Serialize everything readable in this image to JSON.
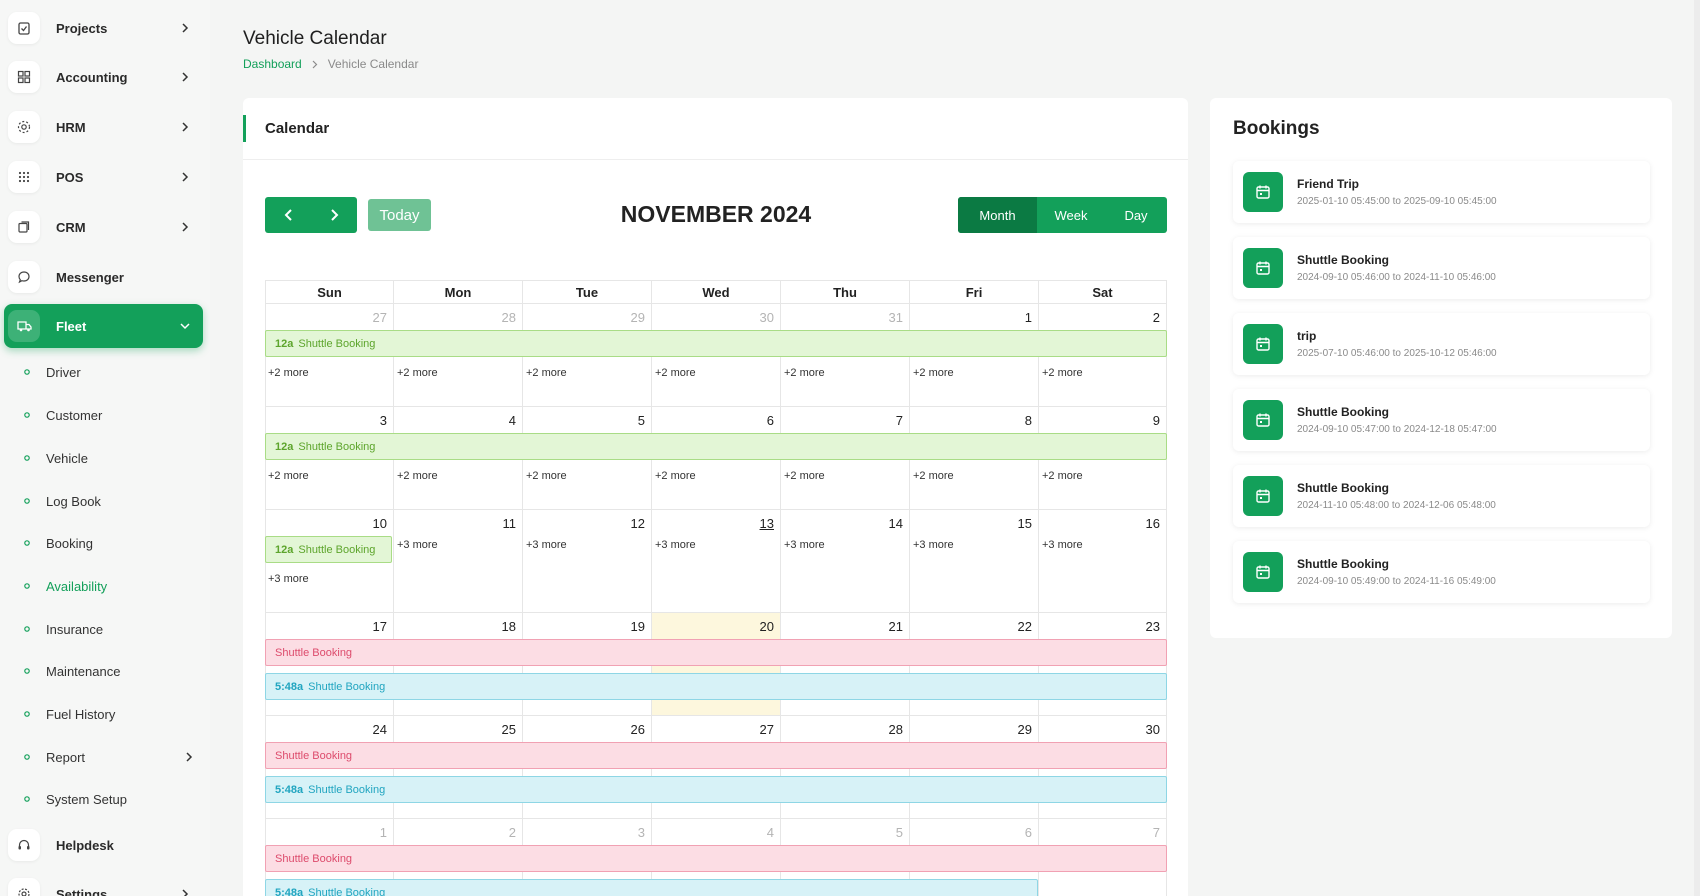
{
  "sidebar": {
    "items": [
      {
        "label": "Projects",
        "icon": "clipboard-check-icon"
      },
      {
        "label": "Accounting",
        "icon": "grid-icon"
      },
      {
        "label": "HRM",
        "icon": "users-icon"
      },
      {
        "label": "POS",
        "icon": "dots-grid-icon"
      },
      {
        "label": "CRM",
        "icon": "layers-icon"
      },
      {
        "label": "Messenger",
        "icon": "chat-icon"
      },
      {
        "label": "Fleet",
        "icon": "truck-icon"
      },
      {
        "label": "Helpdesk",
        "icon": "headset-icon"
      },
      {
        "label": "Settings",
        "icon": "gear-icon"
      }
    ],
    "fleet_sub": [
      "Driver",
      "Customer",
      "Vehicle",
      "Log Book",
      "Booking",
      "Availability",
      "Insurance",
      "Maintenance",
      "Fuel History",
      "Report",
      "System Setup"
    ],
    "active_sub": "Availability"
  },
  "header": {
    "title": "Vehicle Calendar",
    "breadcrumb": [
      "Dashboard",
      "Vehicle Calendar"
    ]
  },
  "calendar": {
    "card_title": "Calendar",
    "today_label": "Today",
    "month_title": "NOVEMBER 2024",
    "views": [
      "Month",
      "Week",
      "Day"
    ],
    "active_view": "Month",
    "weekdays": [
      "Sun",
      "Mon",
      "Tue",
      "Wed",
      "Thu",
      "Fri",
      "Sat"
    ],
    "weeks": [
      {
        "days": [
          "27",
          "28",
          "29",
          "30",
          "31",
          "1",
          "2"
        ],
        "other": [
          true,
          true,
          true,
          true,
          true,
          false,
          false
        ]
      },
      {
        "days": [
          "3",
          "4",
          "5",
          "6",
          "7",
          "8",
          "9"
        ],
        "other": [
          false,
          false,
          false,
          false,
          false,
          false,
          false
        ]
      },
      {
        "days": [
          "10",
          "11",
          "12",
          "13",
          "14",
          "15",
          "16"
        ],
        "other": [
          false,
          false,
          false,
          false,
          false,
          false,
          false
        ]
      },
      {
        "days": [
          "17",
          "18",
          "19",
          "20",
          "21",
          "22",
          "23"
        ],
        "other": [
          false,
          false,
          false,
          false,
          false,
          false,
          false
        ]
      },
      {
        "days": [
          "24",
          "25",
          "26",
          "27",
          "28",
          "29",
          "30"
        ],
        "other": [
          false,
          false,
          false,
          false,
          false,
          false,
          false
        ]
      },
      {
        "days": [
          "1",
          "2",
          "3",
          "4",
          "5",
          "6",
          "7"
        ],
        "other": [
          true,
          true,
          true,
          true,
          true,
          true,
          true
        ]
      }
    ],
    "today": "13",
    "highlight_day": "20",
    "more_labels": {
      "w1": [
        "+2 more",
        "+2 more",
        "+2 more",
        "+2 more",
        "+2 more",
        "+2 more",
        "+2 more"
      ],
      "w2": [
        "+2 more",
        "+2 more",
        "+2 more",
        "+2 more",
        "+2 more",
        "+2 more",
        "+2 more"
      ],
      "w3_sun": "+3 more",
      "w3": [
        "+3 more",
        "+3 more",
        "+3 more",
        "+3 more",
        "+3 more",
        "+3 more"
      ]
    },
    "events": {
      "green_time": "12a",
      "green_title": "Shuttle Booking",
      "pink_title": "Shuttle Booking",
      "cyan_time": "5:48a",
      "cyan_title": "Shuttle Booking"
    },
    "colors": {
      "green": "#e3f6d6",
      "pink": "#fcdde4",
      "cyan": "#d7f2f7",
      "accent": "#13a05a"
    }
  },
  "bookings": {
    "title": "Bookings",
    "items": [
      {
        "name": "Friend Trip",
        "range": "2025-01-10 05:45:00 to 2025-09-10 05:45:00"
      },
      {
        "name": "Shuttle Booking",
        "range": "2024-09-10 05:46:00 to 2024-11-10 05:46:00"
      },
      {
        "name": "trip",
        "range": "2025-07-10 05:46:00 to 2025-10-12 05:46:00"
      },
      {
        "name": "Shuttle Booking",
        "range": "2024-09-10 05:47:00 to 2024-12-18 05:47:00"
      },
      {
        "name": "Shuttle Booking",
        "range": "2024-11-10 05:48:00 to 2024-12-06 05:48:00"
      },
      {
        "name": "Shuttle Booking",
        "range": "2024-09-10 05:49:00 to 2024-11-16 05:49:00"
      }
    ]
  }
}
